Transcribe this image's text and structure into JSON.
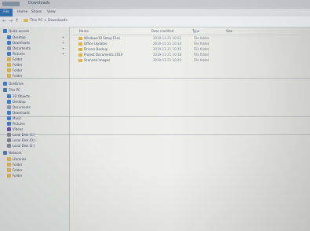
{
  "window": {
    "title": "Downloads",
    "breadcrumb": "This PC > Downloads"
  },
  "ribbon": {
    "tabs": [
      "File",
      "Home",
      "Share",
      "View"
    ]
  },
  "columns": [
    "Name",
    "Date modified",
    "Type",
    "Size"
  ],
  "files": [
    {
      "name": "Windows10 Setup Files",
      "date": "2019-11-21 10:12",
      "type": "File folder"
    },
    {
      "name": "Office Updates",
      "date": "2019-11-21 10:14",
      "type": "File folder"
    },
    {
      "name": "Drivers Backup",
      "date": "2019-11-21 10:15",
      "type": "File folder"
    },
    {
      "name": "Project Documents 2019",
      "date": "2019-11-21 10:18",
      "type": "File folder"
    },
    {
      "name": "Scanned Images",
      "date": "2019-11-21 10:20",
      "type": "File folder"
    }
  ],
  "nav": {
    "quick_access": "Quick access",
    "items": [
      {
        "label": "Desktop",
        "icon": "desktop-icon",
        "color": "#3a7bd5"
      },
      {
        "label": "Downloads",
        "icon": "download-icon",
        "color": "#3a7bd5"
      },
      {
        "label": "Documents",
        "icon": "document-icon",
        "color": "#8a9ab0"
      },
      {
        "label": "Pictures",
        "icon": "picture-icon",
        "color": "#3a7bd5"
      },
      {
        "label": "Folder",
        "icon": "folder-icon",
        "color": "#e2b44a"
      },
      {
        "label": "Folder",
        "icon": "folder-icon",
        "color": "#e2b44a"
      },
      {
        "label": "Folder",
        "icon": "folder-icon",
        "color": "#e2b44a"
      },
      {
        "label": "Folder",
        "icon": "folder-icon",
        "color": "#e2b44a"
      }
    ],
    "onedrive": "OneDrive",
    "this_pc": "This PC",
    "pc_items": [
      {
        "label": "3D Objects",
        "icon": "cube-icon",
        "color": "#3a7bd5"
      },
      {
        "label": "Desktop",
        "icon": "desktop-icon",
        "color": "#3a7bd5"
      },
      {
        "label": "Documents",
        "icon": "document-icon",
        "color": "#8a9ab0"
      },
      {
        "label": "Downloads",
        "icon": "download-icon",
        "color": "#3a7bd5"
      },
      {
        "label": "Music",
        "icon": "music-icon",
        "color": "#3a7bd5"
      },
      {
        "label": "Pictures",
        "icon": "picture-icon",
        "color": "#3a7bd5"
      },
      {
        "label": "Videos",
        "icon": "video-icon",
        "color": "#6a4fb5"
      },
      {
        "label": "Local Disk (C:)",
        "icon": "drive-icon",
        "color": "#7d8794"
      },
      {
        "label": "Local Disk (D:)",
        "icon": "drive-icon",
        "color": "#7d8794"
      },
      {
        "label": "Local Disk (E:)",
        "icon": "drive-icon",
        "color": "#7d8794"
      }
    ],
    "network": "Network",
    "extra_items": [
      {
        "label": "Libraries",
        "icon": "folder-icon",
        "color": "#e2b44a"
      },
      {
        "label": "Folder",
        "icon": "folder-icon",
        "color": "#e2b44a"
      },
      {
        "label": "Folder",
        "icon": "folder-icon",
        "color": "#e2b44a"
      },
      {
        "label": "Folder",
        "icon": "folder-icon",
        "color": "#e2b44a"
      }
    ]
  }
}
